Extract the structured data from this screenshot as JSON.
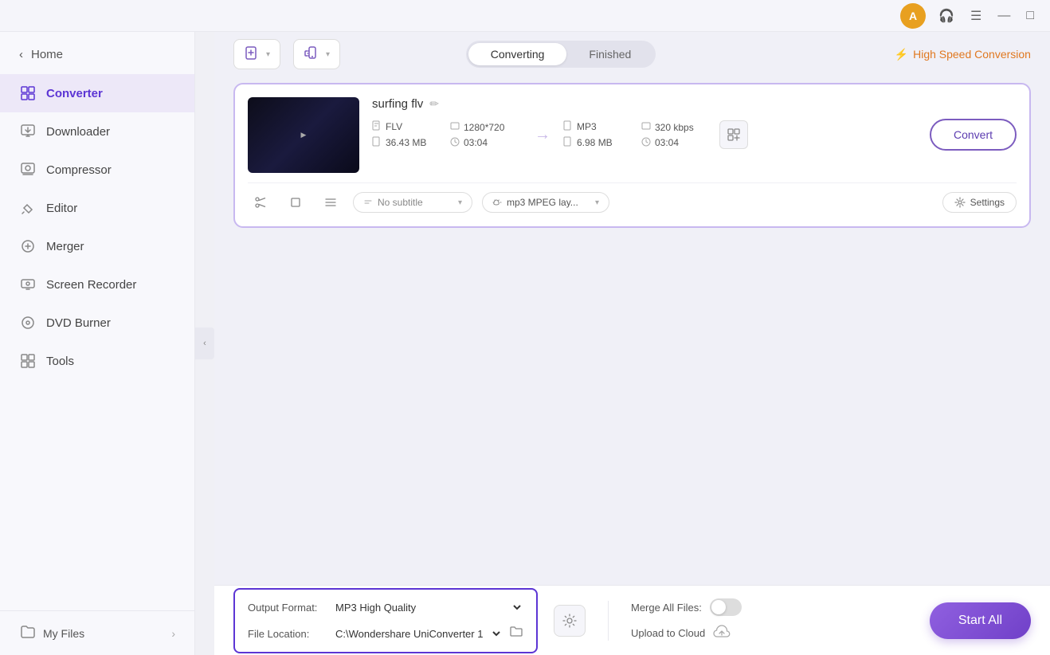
{
  "titlebar": {
    "user_icon": "A",
    "headphone_icon": "🎧",
    "menu_icon": "☰",
    "minimize_icon": "—",
    "maximize_icon": "□"
  },
  "sidebar": {
    "home_label": "Home",
    "back_icon": "‹",
    "items": [
      {
        "id": "converter",
        "label": "Converter",
        "icon": "⊞",
        "active": true
      },
      {
        "id": "downloader",
        "label": "Downloader",
        "icon": "⬇"
      },
      {
        "id": "compressor",
        "label": "Compressor",
        "icon": "🖼"
      },
      {
        "id": "editor",
        "label": "Editor",
        "icon": "✂"
      },
      {
        "id": "merger",
        "label": "Merger",
        "icon": "⊕"
      },
      {
        "id": "screen-recorder",
        "label": "Screen Recorder",
        "icon": "⊙"
      },
      {
        "id": "dvd-burner",
        "label": "DVD Burner",
        "icon": "⊙"
      },
      {
        "id": "tools",
        "label": "Tools",
        "icon": "⊞"
      }
    ],
    "my_files_label": "My Files",
    "my_files_icon": "📁",
    "collapse_icon": "‹"
  },
  "topbar": {
    "add_file_icon": "📄+",
    "add_device_icon": "📱+",
    "add_file_arrow": "▾",
    "add_device_arrow": "▾",
    "tabs": [
      {
        "id": "converting",
        "label": "Converting",
        "active": true
      },
      {
        "id": "finished",
        "label": "Finished",
        "active": false
      }
    ],
    "speed_label": "High Speed Conversion",
    "bolt_icon": "⚡"
  },
  "file_card": {
    "name": "surfing flv",
    "edit_icon": "✏",
    "source": {
      "format": "FLV",
      "resolution": "1280*720",
      "size": "36.43 MB",
      "duration": "03:04"
    },
    "target": {
      "format": "MP3",
      "bitrate": "320 kbps",
      "size": "6.98 MB",
      "duration": "03:04"
    },
    "arrow": "→",
    "subtitle_placeholder": "No subtitle",
    "audio_track": "mp3 MPEG lay...",
    "settings_label": "Settings",
    "convert_label": "Convert",
    "tools": {
      "cut_icon": "✂",
      "crop_icon": "⬜",
      "more_icon": "☰"
    }
  },
  "bottom_bar": {
    "output_format_label": "Output Format:",
    "output_format_value": "MP3 High Quality",
    "file_location_label": "File Location:",
    "file_location_value": "C:\\Wondershare UniConverter 1",
    "folder_icon": "📁",
    "extra_icon": "⊙",
    "merge_label": "Merge All Files:",
    "upload_label": "Upload to Cloud",
    "cloud_icon": "☁",
    "start_label": "Start All"
  }
}
